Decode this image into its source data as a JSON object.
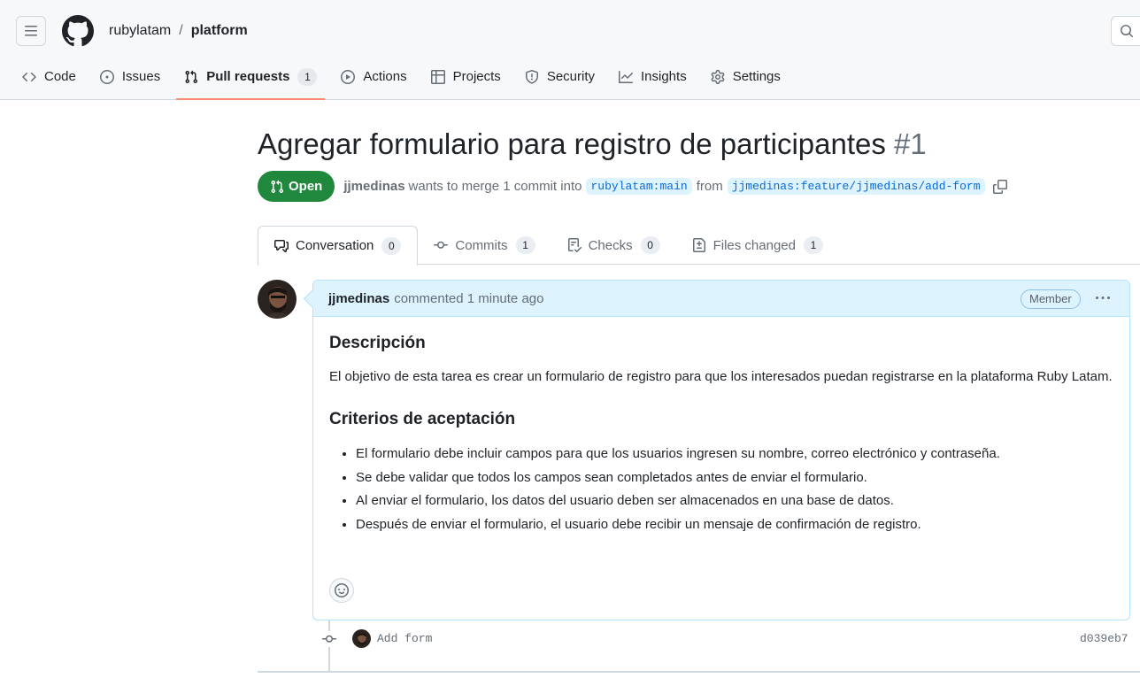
{
  "header": {
    "owner": "rubylatam",
    "separator": "/",
    "repo": "platform"
  },
  "nav": [
    {
      "label": "Code",
      "icon": "code-icon"
    },
    {
      "label": "Issues",
      "icon": "issue-opened-icon"
    },
    {
      "label": "Pull requests",
      "icon": "git-pull-request-icon",
      "count": "1",
      "active": true
    },
    {
      "label": "Actions",
      "icon": "play-icon"
    },
    {
      "label": "Projects",
      "icon": "table-icon"
    },
    {
      "label": "Security",
      "icon": "shield-icon"
    },
    {
      "label": "Insights",
      "icon": "graph-icon"
    },
    {
      "label": "Settings",
      "icon": "gear-icon"
    }
  ],
  "pr": {
    "title": "Agregar formulario para registro de participantes",
    "number": "#1",
    "state": "Open",
    "state_color": "#1f883d",
    "author": "jjmedinas",
    "merge_text": "wants to merge 1 commit into",
    "base_branch": "rubylatam:main",
    "from_text": "from",
    "head_branch": "jjmedinas:feature/jjmedinas/add-form"
  },
  "tabs": [
    {
      "label": "Conversation",
      "count": "0",
      "icon": "comment-discussion-icon",
      "selected": true
    },
    {
      "label": "Commits",
      "count": "1",
      "icon": "git-commit-icon"
    },
    {
      "label": "Checks",
      "count": "0",
      "icon": "checklist-icon"
    },
    {
      "label": "Files changed",
      "count": "1",
      "icon": "file-diff-icon"
    }
  ],
  "comment": {
    "author": "jjmedinas",
    "meta": "commented 1 minute ago",
    "badge": "Member",
    "heading1": "Descripción",
    "paragraph": "El objetivo de esta tarea es crear un formulario de registro para que los interesados puedan registrarse en la plataforma Ruby Latam.",
    "heading2": "Criterios de aceptación",
    "criteria": [
      "El formulario debe incluir campos para que los usuarios ingresen su nombre, correo electrónico y contraseña.",
      "Se debe validar que todos los campos sean completados antes de enviar el formulario.",
      "Al enviar el formulario, los datos del usuario deben ser almacenados en una base de datos.",
      "Después de enviar el formulario, el usuario debe recibir un mensaje de confirmación de registro."
    ]
  },
  "commit": {
    "message": "Add form",
    "sha": "d039eb7"
  },
  "colors": {
    "accent_link": "#0969da",
    "tab_underline": "#fd8c73",
    "comment_header": "#ddf4ff"
  }
}
